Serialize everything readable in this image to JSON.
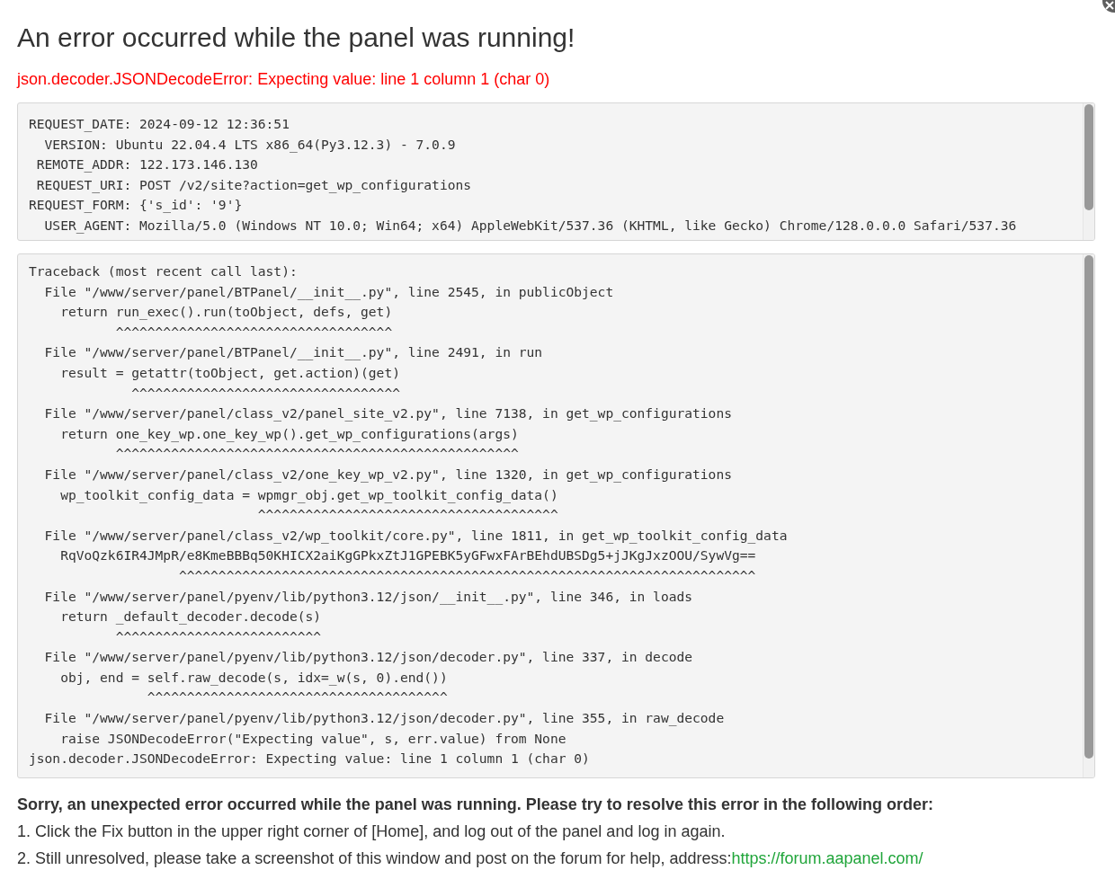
{
  "title": "An error occurred while the panel was running!",
  "error_message": "json.decoder.JSONDecodeError: Expecting value: line 1 column 1 (char 0)",
  "request_info": [
    "REQUEST_DATE: 2024-09-12 12:36:51",
    "  VERSION: Ubuntu 22.04.4 LTS x86_64(Py3.12.3) - 7.0.9",
    " REMOTE_ADDR: 122.173.146.130",
    " REQUEST_URI: POST /v2/site?action=get_wp_configurations",
    "REQUEST_FORM: {'s_id': '9'}",
    "  USER_AGENT: Mozilla/5.0 (Windows NT 10.0; Win64; x64) AppleWebKit/537.36 (KHTML, like Gecko) Chrome/128.0.0.0 Safari/537.36"
  ],
  "traceback": [
    "Traceback (most recent call last):",
    "  File \"/www/server/panel/BTPanel/__init__.py\", line 2545, in publicObject",
    "    return run_exec().run(toObject, defs, get)",
    "           ^^^^^^^^^^^^^^^^^^^^^^^^^^^^^^^^^^^",
    "  File \"/www/server/panel/BTPanel/__init__.py\", line 2491, in run",
    "    result = getattr(toObject, get.action)(get)",
    "             ^^^^^^^^^^^^^^^^^^^^^^^^^^^^^^^^^^",
    "  File \"/www/server/panel/class_v2/panel_site_v2.py\", line 7138, in get_wp_configurations",
    "    return one_key_wp.one_key_wp().get_wp_configurations(args)",
    "           ^^^^^^^^^^^^^^^^^^^^^^^^^^^^^^^^^^^^^^^^^^^^^^^^^^^",
    "  File \"/www/server/panel/class_v2/one_key_wp_v2.py\", line 1320, in get_wp_configurations",
    "    wp_toolkit_config_data = wpmgr_obj.get_wp_toolkit_config_data()",
    "                             ^^^^^^^^^^^^^^^^^^^^^^^^^^^^^^^^^^^^^^",
    "  File \"/www/server/panel/class_v2/wp_toolkit/core.py\", line 1811, in get_wp_toolkit_config_data",
    "    RqVoQzk6IR4JMpR/e8KmeBBBq50KHICX2aiKgGPkxZtJ1GPEBK5yGFwxFArBEhdUBSDg5+jJKgJxzOOU/SywVg==",
    "                   ^^^^^^^^^^^^^^^^^^^^^^^^^^^^^^^^^^^^^^^^^^^^^^^^^^^^^^^^^^^^^^^^^^^^^^^^^",
    "  File \"/www/server/panel/pyenv/lib/python3.12/json/__init__.py\", line 346, in loads",
    "    return _default_decoder.decode(s)",
    "           ^^^^^^^^^^^^^^^^^^^^^^^^^^",
    "  File \"/www/server/panel/pyenv/lib/python3.12/json/decoder.py\", line 337, in decode",
    "    obj, end = self.raw_decode(s, idx=_w(s, 0).end())",
    "               ^^^^^^^^^^^^^^^^^^^^^^^^^^^^^^^^^^^^^^",
    "  File \"/www/server/panel/pyenv/lib/python3.12/json/decoder.py\", line 355, in raw_decode",
    "    raise JSONDecodeError(\"Expecting value\", s, err.value) from None",
    "json.decoder.JSONDecodeError: Expecting value: line 1 column 1 (char 0)"
  ],
  "help": {
    "heading": "Sorry, an unexpected error occurred while the panel was running. Please try to resolve this error in the following order:",
    "steps": [
      {
        "text": "1. Click the Fix button in the upper right corner of [Home], and log out of the panel and log in again."
      },
      {
        "text": "2. Still unresolved, please take a screenshot of this window and post on the forum for help, address:",
        "link": "https://forum.aapanel.com/"
      }
    ]
  }
}
